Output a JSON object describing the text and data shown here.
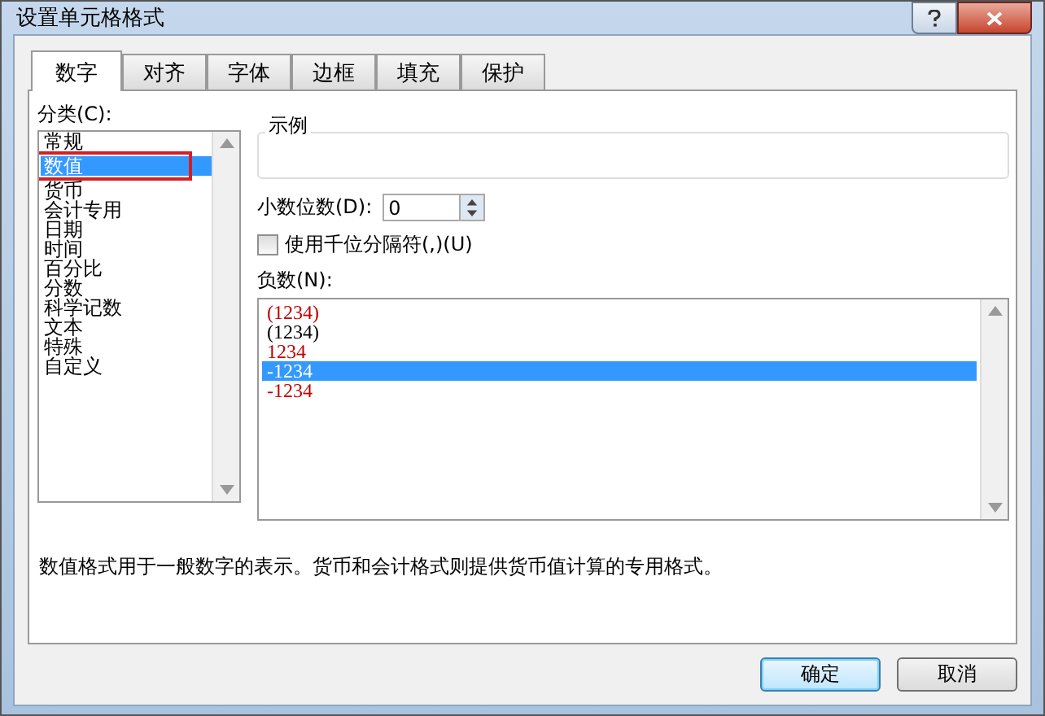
{
  "window": {
    "title": "设置单元格格式"
  },
  "tabs": [
    {
      "label": "数字",
      "selected": true
    },
    {
      "label": "对齐",
      "selected": false
    },
    {
      "label": "字体",
      "selected": false
    },
    {
      "label": "边框",
      "selected": false
    },
    {
      "label": "填充",
      "selected": false
    },
    {
      "label": "保护",
      "selected": false
    }
  ],
  "category": {
    "label": "分类(C):",
    "items": [
      {
        "label": "常规",
        "selected": false
      },
      {
        "label": "数值",
        "selected": true
      },
      {
        "label": "货币",
        "selected": false
      },
      {
        "label": "会计专用",
        "selected": false
      },
      {
        "label": "日期",
        "selected": false
      },
      {
        "label": "时间",
        "selected": false
      },
      {
        "label": "百分比",
        "selected": false
      },
      {
        "label": "分数",
        "selected": false
      },
      {
        "label": "科学记数",
        "selected": false
      },
      {
        "label": "文本",
        "selected": false
      },
      {
        "label": "特殊",
        "selected": false
      },
      {
        "label": "自定义",
        "selected": false
      }
    ]
  },
  "sample": {
    "label": "示例"
  },
  "decimal_places": {
    "label": "小数位数(D):",
    "value": "0"
  },
  "thousands_separator": {
    "label": "使用千位分隔符(,)(U)",
    "checked": false
  },
  "negative_numbers": {
    "label": "负数(N):",
    "items": [
      {
        "label": "(1234)",
        "color": "#c00000",
        "selected": false
      },
      {
        "label": "(1234)",
        "color": "#000000",
        "selected": false
      },
      {
        "label": "1234",
        "color": "#c00000",
        "selected": false
      },
      {
        "label": "-1234",
        "selected": true
      },
      {
        "label": "-1234",
        "color": "#c00000",
        "selected": false
      }
    ]
  },
  "description": "数值格式用于一般数字的表示。货币和会计格式则提供货币值计算的专用格式。",
  "buttons": [
    {
      "label": "确定",
      "kind": "default"
    },
    {
      "label": "取消",
      "kind": "normal"
    }
  ]
}
